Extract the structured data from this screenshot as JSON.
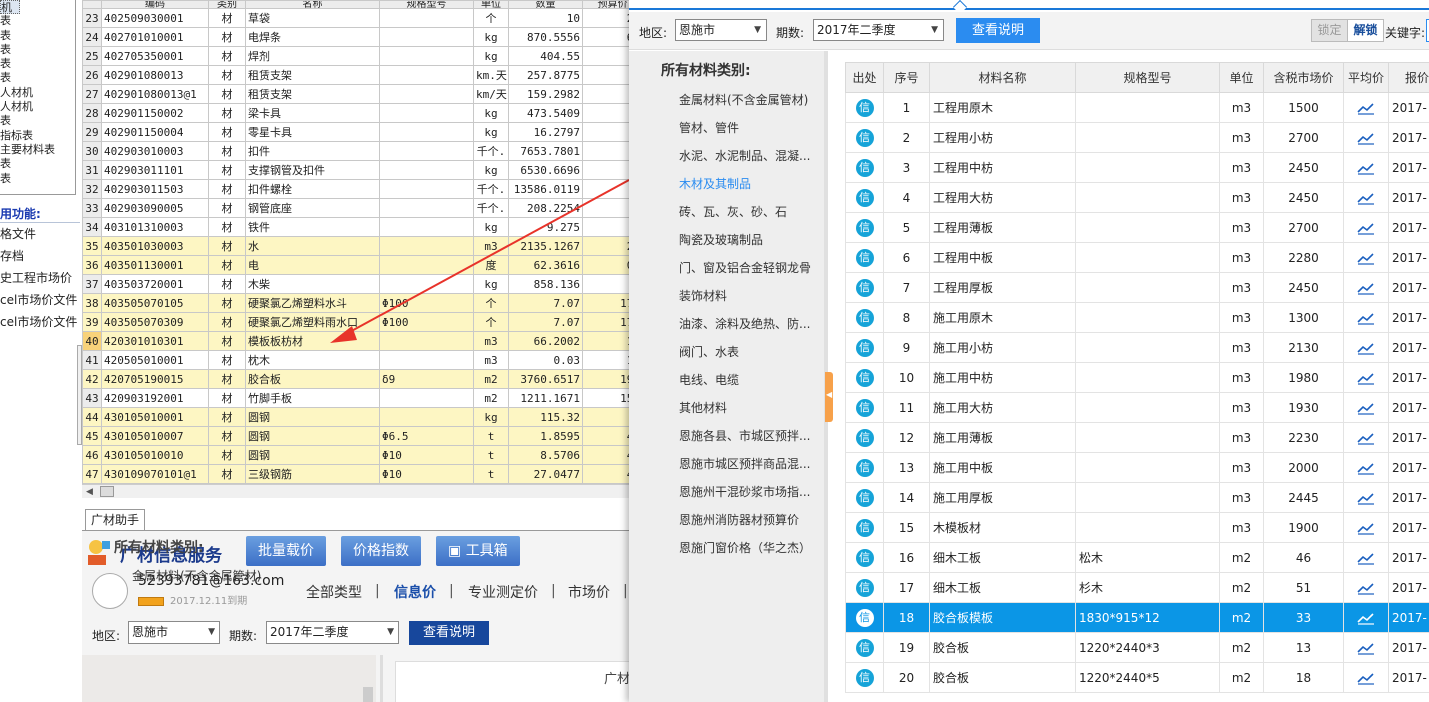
{
  "left_tree": {
    "items": [
      "机",
      "表",
      "表",
      "表",
      "表",
      "表",
      "人材机",
      "人材机",
      "表",
      "指标表",
      "主要材料表",
      "表",
      "表"
    ]
  },
  "left_functions": {
    "title": "用功能:",
    "items": [
      "格文件",
      "存档",
      "史工程市场价",
      "cel市场价文件",
      "cel市场价文件"
    ]
  },
  "material_grid": {
    "header": [
      "编码",
      "类别",
      "名称",
      "规格型号",
      "单位",
      "数量",
      "预算价"
    ],
    "rows": [
      {
        "idx": "23",
        "code": "402509030001",
        "type": "材",
        "name": "草袋",
        "spec": "",
        "unit": "个",
        "qty": "10",
        "price": "2.",
        "hl": false
      },
      {
        "idx": "24",
        "code": "402701010001",
        "type": "材",
        "name": "电焊条",
        "spec": "",
        "unit": "kg",
        "qty": "870.5556",
        "price": "6.",
        "hl": false
      },
      {
        "idx": "25",
        "code": "402705350001",
        "type": "材",
        "name": "焊剂",
        "spec": "",
        "unit": "kg",
        "qty": "404.55",
        "price": "",
        "hl": false
      },
      {
        "idx": "26",
        "code": "402901080013",
        "type": "材",
        "name": "租赁支架",
        "spec": "",
        "unit": "km.天",
        "qty": "257.8775",
        "price": "",
        "hl": false
      },
      {
        "idx": "27",
        "code": "402901080013@1",
        "type": "材",
        "name": "租赁支架",
        "spec": "",
        "unit": "km/天",
        "qty": "159.2982",
        "price": "",
        "hl": false
      },
      {
        "idx": "28",
        "code": "402901150002",
        "type": "材",
        "name": "梁卡具",
        "spec": "",
        "unit": "kg",
        "qty": "473.5409",
        "price": "5",
        "hl": false
      },
      {
        "idx": "29",
        "code": "402901150004",
        "type": "材",
        "name": "零星卡具",
        "spec": "",
        "unit": "kg",
        "qty": "16.2797",
        "price": "5",
        "hl": false
      },
      {
        "idx": "30",
        "code": "402903010003",
        "type": "材",
        "name": "扣件",
        "spec": "",
        "unit": "千个.",
        "qty": "7653.7801",
        "price": "",
        "hl": false
      },
      {
        "idx": "31",
        "code": "402903011101",
        "type": "材",
        "name": "支撑钢管及扣件",
        "spec": "",
        "unit": "kg",
        "qty": "6530.6696",
        "price": "5",
        "hl": false
      },
      {
        "idx": "32",
        "code": "402903011503",
        "type": "材",
        "name": "扣件螺栓",
        "spec": "",
        "unit": "千个.",
        "qty": "13586.0119",
        "price": "",
        "hl": false
      },
      {
        "idx": "33",
        "code": "402903090005",
        "type": "材",
        "name": "钢管底座",
        "spec": "",
        "unit": "千个.",
        "qty": "208.2254",
        "price": "",
        "hl": false
      },
      {
        "idx": "34",
        "code": "403101310003",
        "type": "材",
        "name": "铁件",
        "spec": "",
        "unit": "kg",
        "qty": "9.275",
        "price": "5",
        "hl": false
      },
      {
        "idx": "35",
        "code": "403501030003",
        "type": "材",
        "name": "水",
        "spec": "",
        "unit": "m3",
        "qty": "2135.1267",
        "price": "2.",
        "hl": true
      },
      {
        "idx": "36",
        "code": "403501130001",
        "type": "材",
        "name": "电",
        "spec": "",
        "unit": "度",
        "qty": "62.3616",
        "price": "0.",
        "hl": true
      },
      {
        "idx": "37",
        "code": "403503720001",
        "type": "材",
        "name": "木柴",
        "spec": "",
        "unit": "kg",
        "qty": "858.136",
        "price": "0",
        "hl": false
      },
      {
        "idx": "38",
        "code": "403505070105",
        "type": "材",
        "name": "硬聚氯乙烯塑料水斗",
        "spec": "Φ100",
        "unit": "个",
        "qty": "7.07",
        "price": "17.",
        "hl": true
      },
      {
        "idx": "39",
        "code": "403505070309",
        "type": "材",
        "name": "硬聚氯乙烯塑料雨水口",
        "spec": "Φ100",
        "unit": "个",
        "qty": "7.07",
        "price": "17.",
        "hl": true
      },
      {
        "idx": "40",
        "code": "420301010301",
        "type": "材",
        "name": "模板板枋材",
        "spec": "",
        "unit": "m3",
        "qty": "66.2002",
        "price": "15",
        "hl": true,
        "sel": true
      },
      {
        "idx": "41",
        "code": "420505010001",
        "type": "材",
        "name": "枕木",
        "spec": "",
        "unit": "m3",
        "qty": "0.03",
        "price": "19",
        "hl": false
      },
      {
        "idx": "42",
        "code": "420705190015",
        "type": "材",
        "name": "胶合板",
        "spec": "δ9",
        "unit": "m2",
        "qty": "3760.6517",
        "price": "19.",
        "hl": true
      },
      {
        "idx": "43",
        "code": "420903192001",
        "type": "材",
        "name": "竹脚手板",
        "spec": "",
        "unit": "m2",
        "qty": "1211.1671",
        "price": "15.",
        "hl": false
      },
      {
        "idx": "44",
        "code": "430105010001",
        "type": "材",
        "name": "圆钢",
        "spec": "",
        "unit": "kg",
        "qty": "115.32",
        "price": "4",
        "hl": true
      },
      {
        "idx": "45",
        "code": "430105010007",
        "type": "材",
        "name": "圆钢",
        "spec": "Φ6.5",
        "unit": "t",
        "qty": "1.8595",
        "price": "42",
        "hl": true
      },
      {
        "idx": "46",
        "code": "430105010010",
        "type": "材",
        "name": "圆钢",
        "spec": "Φ10",
        "unit": "t",
        "qty": "8.5706",
        "price": "42",
        "hl": true
      },
      {
        "idx": "47",
        "code": "430109070101@1",
        "type": "材",
        "name": "三级钢筋",
        "spec": "Φ10",
        "unit": "t",
        "qty": "27.0477",
        "price": "45",
        "hl": true
      }
    ]
  },
  "assistant": {
    "tab_label": "广材助手",
    "brand": "广材信息服务",
    "btn_batch": "批量载价",
    "btn_index": "价格指数",
    "btn_tools": "工具箱",
    "email": "52393781@163.com",
    "expire": "2017.12.11到期",
    "nav": [
      "全部类型",
      "信息价",
      "专业测定价",
      "市场价"
    ],
    "region_label": "地区:",
    "region_value": "恩施市",
    "period_label": "期数:",
    "period_value": "2017年二季度",
    "note_button": "查看说明",
    "cat_title": "所有材料类别:",
    "cat_first": "金属材料(不含金属管材)",
    "right_text": "广材"
  },
  "panel": {
    "region_label": "地区:",
    "region_value": "恩施市",
    "period_label": "期数:",
    "period_value": "2017年二季度",
    "note_button": "查看说明",
    "lock_button": "锁定",
    "unlock_button": "解锁",
    "keyword_label": "关键字:",
    "cat_title": "所有材料类别:",
    "categories": [
      "金属材料(不含金属管材)",
      "管材、管件",
      "水泥、水泥制品、混凝...",
      "木材及其制品",
      "砖、瓦、灰、砂、石",
      "陶瓷及玻璃制品",
      "门、窗及铝合金轻钢龙骨",
      "装饰材料",
      "油漆、涂料及绝热、防...",
      "阀门、水表",
      "电线、电缆",
      "其他材料",
      "恩施各县、市城区预拌...",
      "恩施市城区预拌商品混...",
      "恩施州干混砂浆市场指...",
      "恩施州消防器材预算价",
      "恩施门窗价格（华之杰）"
    ],
    "active_category": 3,
    "columns": [
      "出处",
      "序号",
      "材料名称",
      "规格型号",
      "单位",
      "含税市场价",
      "平均价",
      "报价"
    ],
    "info_glyph": "信",
    "rows": [
      {
        "no": "1",
        "name": "工程用原木",
        "spec": "",
        "unit": "m3",
        "price": "1500",
        "date": "2017-"
      },
      {
        "no": "2",
        "name": "工程用小枋",
        "spec": "",
        "unit": "m3",
        "price": "2700",
        "date": "2017-"
      },
      {
        "no": "3",
        "name": "工程用中枋",
        "spec": "",
        "unit": "m3",
        "price": "2450",
        "date": "2017-"
      },
      {
        "no": "4",
        "name": "工程用大枋",
        "spec": "",
        "unit": "m3",
        "price": "2450",
        "date": "2017-"
      },
      {
        "no": "5",
        "name": "工程用薄板",
        "spec": "",
        "unit": "m3",
        "price": "2700",
        "date": "2017-"
      },
      {
        "no": "6",
        "name": "工程用中板",
        "spec": "",
        "unit": "m3",
        "price": "2280",
        "date": "2017-"
      },
      {
        "no": "7",
        "name": "工程用厚板",
        "spec": "",
        "unit": "m3",
        "price": "2450",
        "date": "2017-"
      },
      {
        "no": "8",
        "name": "施工用原木",
        "spec": "",
        "unit": "m3",
        "price": "1300",
        "date": "2017-"
      },
      {
        "no": "9",
        "name": "施工用小枋",
        "spec": "",
        "unit": "m3",
        "price": "2130",
        "date": "2017-"
      },
      {
        "no": "10",
        "name": "施工用中枋",
        "spec": "",
        "unit": "m3",
        "price": "1980",
        "date": "2017-"
      },
      {
        "no": "11",
        "name": "施工用大枋",
        "spec": "",
        "unit": "m3",
        "price": "1930",
        "date": "2017-"
      },
      {
        "no": "12",
        "name": "施工用薄板",
        "spec": "",
        "unit": "m3",
        "price": "2230",
        "date": "2017-"
      },
      {
        "no": "13",
        "name": "施工用中板",
        "spec": "",
        "unit": "m3",
        "price": "2000",
        "date": "2017-"
      },
      {
        "no": "14",
        "name": "施工用厚板",
        "spec": "",
        "unit": "m3",
        "price": "2445",
        "date": "2017-"
      },
      {
        "no": "15",
        "name": "木模板材",
        "spec": "",
        "unit": "m3",
        "price": "1900",
        "date": "2017-"
      },
      {
        "no": "16",
        "name": "细木工板",
        "spec": "松木",
        "unit": "m2",
        "price": "46",
        "date": "2017-"
      },
      {
        "no": "17",
        "name": "细木工板",
        "spec": "杉木",
        "unit": "m2",
        "price": "51",
        "date": "2017-"
      },
      {
        "no": "18",
        "name": "胶合板模板",
        "spec": "1830*915*12",
        "unit": "m2",
        "price": "33",
        "date": "2017-",
        "sel": true
      },
      {
        "no": "19",
        "name": "胶合板",
        "spec": "1220*2440*3",
        "unit": "m2",
        "price": "13",
        "date": "2017-"
      },
      {
        "no": "20",
        "name": "胶合板",
        "spec": "1220*2440*5",
        "unit": "m2",
        "price": "18",
        "date": "2017-"
      }
    ]
  },
  "colors": {
    "accent": "#2b8cf0",
    "selected_row": "#0b96e6",
    "highlight_row": "#fdf6c3",
    "arrow": "#e8332a"
  }
}
